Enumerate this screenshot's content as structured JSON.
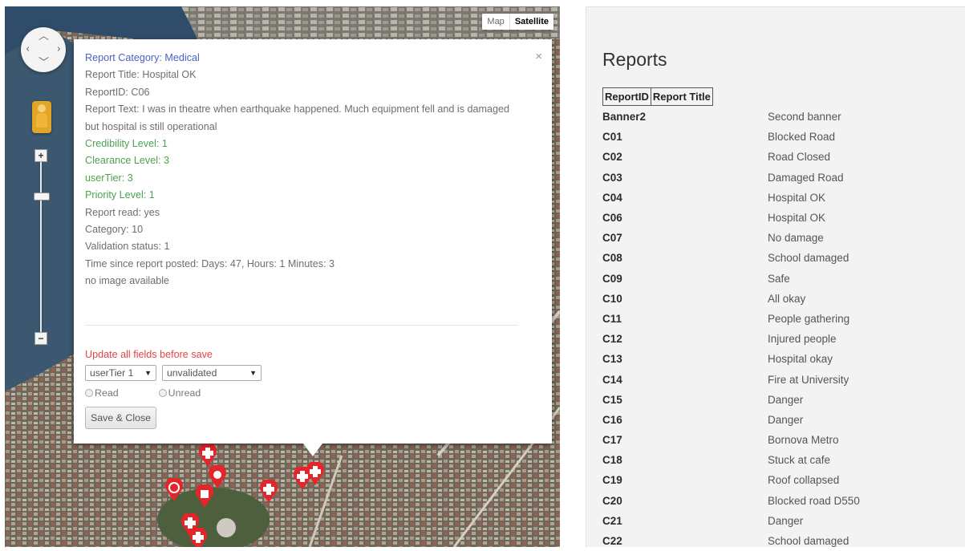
{
  "map": {
    "map_type": {
      "map": "Map",
      "satellite": "Satellite",
      "selected": "Satellite"
    }
  },
  "info": {
    "close": "×",
    "lines": [
      {
        "text": "Report Category: Medical",
        "color": "#4c5fc4"
      },
      {
        "text": "Report Title: Hospital OK"
      },
      {
        "text": "ReportID: C06"
      },
      {
        "text": "Report Text: I was in theatre when earthquake happened. Much equipment fell and is damaged but hospital is still operational"
      },
      {
        "text": "Credibility Level: 1",
        "color": "#4fa04f"
      },
      {
        "text": "Clearance Level: 3",
        "color": "#4fa04f"
      },
      {
        "text": "userTier: 3",
        "color": "#4fa04f"
      },
      {
        "text": "Priority Level: 1",
        "color": "#4fa04f"
      },
      {
        "text": "Report read: yes"
      },
      {
        "text": "Category: 10"
      },
      {
        "text": "Validation status: 1"
      },
      {
        "text": "Time since report posted: Days: 47, Hours: 1 Minutes: 3"
      },
      {
        "text": "no image available"
      }
    ],
    "update_notice": "Update all fields before save",
    "tier_select": "userTier 1",
    "status_select": "unvalidated",
    "radio_read": "Read",
    "radio_unread": "Unread",
    "save_button": "Save & Close"
  },
  "reports": {
    "title": "Reports",
    "col_id": "ReportID",
    "col_title": "Report Title",
    "rows": [
      {
        "id": "Banner2",
        "title": "Second banner"
      },
      {
        "id": "C01",
        "title": "Blocked Road"
      },
      {
        "id": "C02",
        "title": "Road Closed"
      },
      {
        "id": "C03",
        "title": "Damaged Road"
      },
      {
        "id": "C04",
        "title": "Hospital OK"
      },
      {
        "id": "C06",
        "title": "Hospital OK"
      },
      {
        "id": "C07",
        "title": "No damage"
      },
      {
        "id": "C08",
        "title": "School damaged"
      },
      {
        "id": "C09",
        "title": "Safe"
      },
      {
        "id": "C10",
        "title": "All okay"
      },
      {
        "id": "C11",
        "title": "People gathering"
      },
      {
        "id": "C12",
        "title": "Injured people"
      },
      {
        "id": "C13",
        "title": "Hospital okay"
      },
      {
        "id": "C14",
        "title": "Fire at University"
      },
      {
        "id": "C15",
        "title": "Danger"
      },
      {
        "id": "C16",
        "title": "Danger"
      },
      {
        "id": "C17",
        "title": "Bornova Metro"
      },
      {
        "id": "C18",
        "title": "Stuck at cafe"
      },
      {
        "id": "C19",
        "title": "Roof collapsed"
      },
      {
        "id": "C20",
        "title": "Blocked road D550"
      },
      {
        "id": "C21",
        "title": "Danger"
      },
      {
        "id": "C22",
        "title": "School damaged"
      }
    ]
  },
  "colors": {
    "category_text": "#4c5fc4",
    "level_text": "#4fa04f",
    "warning_text": "#e04444",
    "marker_red": "#e3262a"
  }
}
